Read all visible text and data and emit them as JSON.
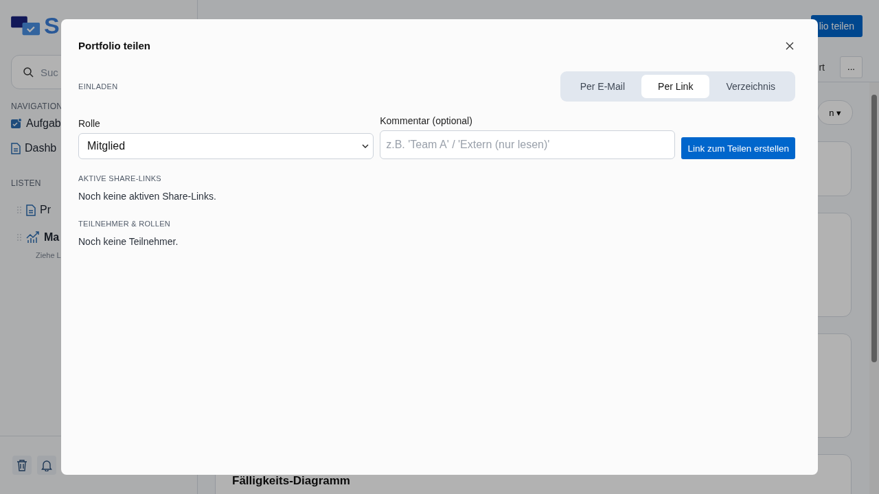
{
  "background": {
    "sidebar": {
      "logo_text": "S",
      "search_placeholder": "Suc",
      "nav_heading": "NAVIGATION",
      "nav_items": [
        {
          "label": "Aufgab",
          "kind": "tasks"
        },
        {
          "label": "Dashb",
          "kind": "doc"
        }
      ],
      "lists_heading": "LISTEN",
      "list_items": [
        {
          "label": "Pr",
          "kind": "doc",
          "bold": false
        },
        {
          "label": "Ma",
          "kind": "chart",
          "bold": true
        }
      ],
      "hint": "Ziehe L"
    },
    "header": {
      "share_button": "lio teilen",
      "export_button": "rt",
      "more_button": "..."
    },
    "filter": "n",
    "filter_caret": "▾",
    "card_title": "Fälligkeits-Diagramm"
  },
  "dialog": {
    "title": "Portfolio teilen",
    "section": "EINLADEN",
    "tabs": [
      {
        "label": "Per E-Mail",
        "selected": false
      },
      {
        "label": "Per Link",
        "selected": true
      },
      {
        "label": "Verzeichnis",
        "selected": false
      }
    ],
    "role": {
      "label": "Rolle",
      "value": "Mitglied"
    },
    "comment": {
      "label": "Kommentar (optional)",
      "placeholder": "z.B. 'Team A' / 'Extern (nur lesen)'"
    },
    "create_button": "Link zum Teilen erstellen",
    "links": {
      "heading": "AKTIVE SHARE-LINKS",
      "empty": "Noch keine aktiven Share-Links."
    },
    "members": {
      "heading": "TEILNEHMER & ROLLEN",
      "empty": "Noch keine Teilnehmer."
    }
  }
}
